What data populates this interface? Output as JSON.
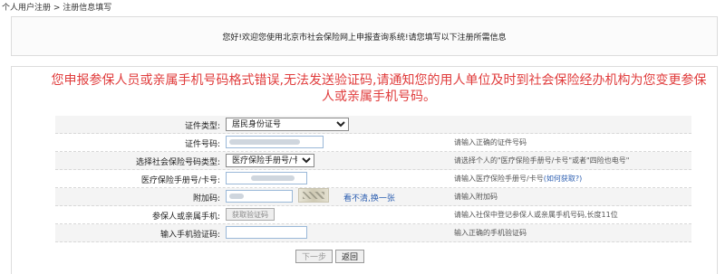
{
  "breadcrumb": "个人用户注册 > 注册信息填写",
  "welcome": "您好!欢迎您使用北京市社会保险网上申报查询系统!请您填写以下注册所需信息",
  "error_message": "您申报参保人员或亲属手机号码格式错误,无法发送验证码,请通知您的用人单位及时到社会保险经办机构为您变更参保人或亲属手机号码。",
  "form": {
    "id_type": {
      "label": "证件类型:",
      "selected": "居民身份证号"
    },
    "id_number": {
      "label": "证件号码:",
      "hint": "请输入正确的证件号码"
    },
    "medical_type": {
      "label": "选择社会保险号码类型:",
      "selected": "医疗保险手册号/卡号",
      "hint": "请选择个人的\"医疗保险手册号/卡号\"或者\"四险也电号\""
    },
    "medical_number": {
      "label": "医疗保险手册号/卡号:",
      "hint": "请输入医疗保险手册号/卡号",
      "hint_link": "(如何获取?)"
    },
    "captcha": {
      "label": "附加码:",
      "refresh": "看不清,换一张",
      "hint": "请输入附加码"
    },
    "phone": {
      "label": "参保人或亲属手机:",
      "button": "获取验证码",
      "hint": "请输入社保中登记参保人或亲属手机号码,长度11位"
    },
    "sms_code": {
      "label": "输入手机验证码:",
      "hint": "输入正确的手机验证码"
    }
  },
  "buttons": {
    "next": "下一步",
    "back": "返回"
  }
}
